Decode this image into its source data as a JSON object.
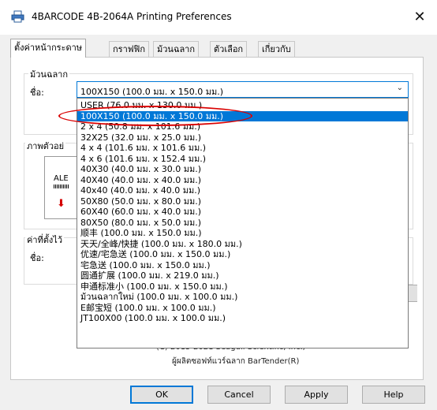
{
  "window": {
    "title": "4BARCODE 4B-2064A Printing Preferences",
    "close_glyph": "✕"
  },
  "tabs": [
    {
      "label": "ตั้งค่าหน้ากระดาษ",
      "active": true
    },
    {
      "label": "กราฟฟิก"
    },
    {
      "label": "ม้วนฉลาก"
    },
    {
      "label": "ตัวเลือก"
    },
    {
      "label": "เกี่ยวกับ"
    }
  ],
  "stock_group": {
    "label": "ม้วนฉลาก",
    "name_label": "ชื่อ:"
  },
  "size_select": {
    "value": "100X150 (100.0 มม. x 150.0 มม.)"
  },
  "dropdown_options": [
    "USER (76.0 มม. x 130.0 มม.)",
    "100X150 (100.0 มม. x 150.0 มม.)",
    "2 x 4 (50.8 มม. x 101.6 มม.)",
    "32X25 (32.0 มม. x 25.0 มม.)",
    "4 x 4 (101.6 มม. x 101.6 มม.)",
    "4 x 6 (101.6 มม. x 152.4 มม.)",
    "40X30 (40.0 มม. x 30.0 มม.)",
    "40X40 (40.0 มม. x 40.0 มม.)",
    "40x40 (40.0 มม. x 40.0 มม.)",
    "50X80 (50.0 มม. x 80.0 มม.)",
    "60X40 (60.0 มม. x 40.0 มม.)",
    "80X50 (80.0 มม. x 50.0 มม.)",
    "顺丰 (100.0 มม. x 150.0 มม.)",
    "天天/全峰/快捷 (100.0 มม. x 180.0 มม.)",
    "优速/宅急送 (100.0 มม. x 150.0 มม.)",
    "宅急送 (100.0 มม. x 150.0 มม.)",
    "圆通扩展 (100.0 มม. x 219.0 มม.)",
    "申通标准小 (100.0 มม. x 150.0 มม.)",
    "ม้วนฉลากใหม่ (100.0 มม. x 100.0 มม.)",
    "E邮宝短 (100.0 มม. x 100.0 มม.)",
    "JT100X00 (100.0 มม. x 100.0 มม.)"
  ],
  "selected_option_index": 1,
  "preview_group": {
    "label": "ภาพตัวอย่",
    "sample_text": "ALE",
    "arrow_glyph": "⬇"
  },
  "settings_group": {
    "label": "ค่าที่ตั้งไว้",
    "name_label": "ชื่อ:"
  },
  "footer": {
    "copyright": "(C) 2015-2021 Seagull Scientific, Inc.,",
    "producer": "ผู้ผลิตซอฟท์แวร์ฉลาก BarTender(R)"
  },
  "buttons": {
    "ok": "OK",
    "cancel": "Cancel",
    "apply": "Apply",
    "help": "Help"
  }
}
